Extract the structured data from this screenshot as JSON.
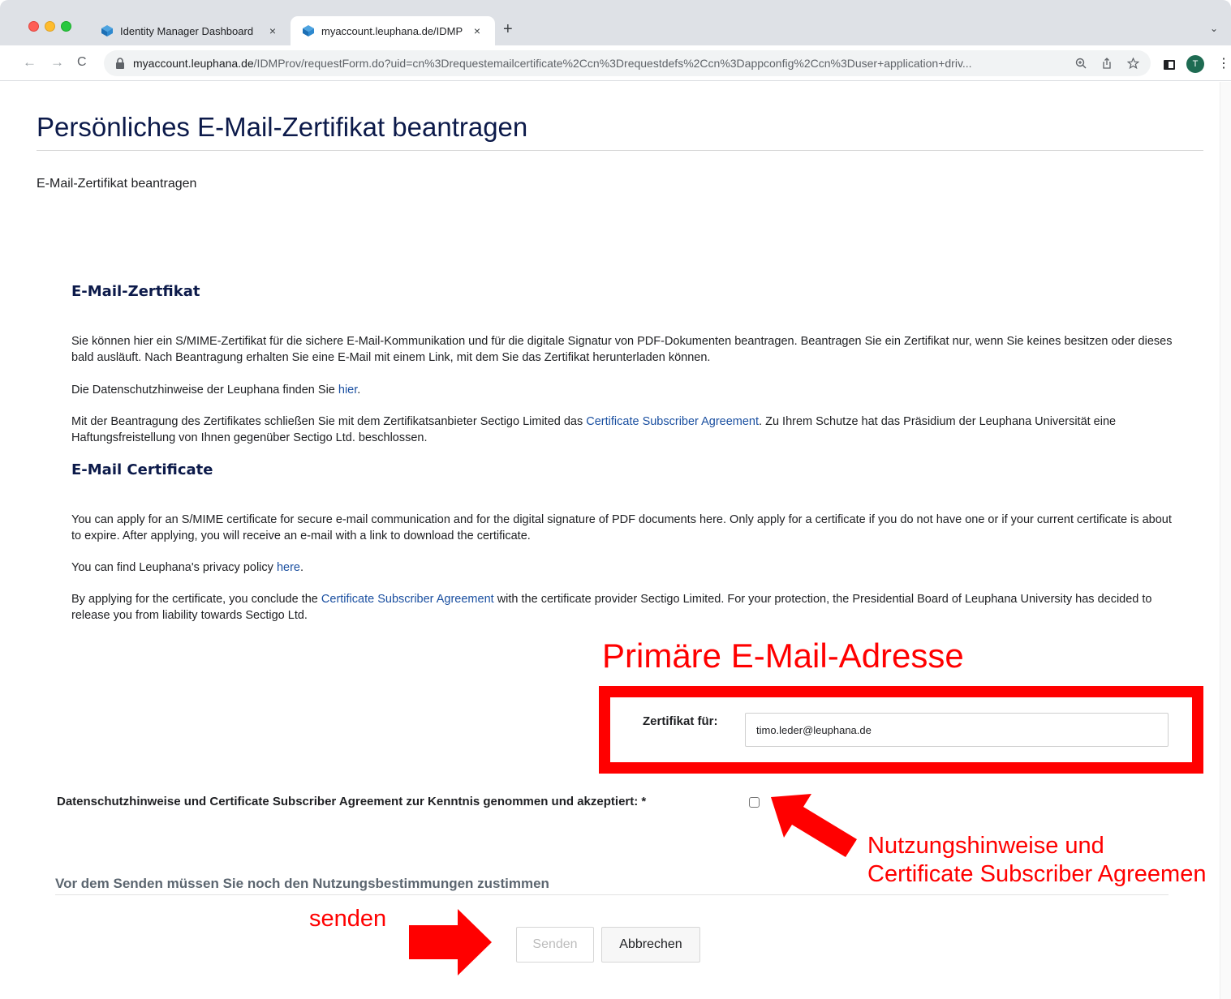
{
  "browser": {
    "tabs": [
      {
        "title": "Identity Manager Dashboard",
        "active": false
      },
      {
        "title": "myaccount.leuphana.de/IDMP",
        "active": true
      }
    ],
    "new_tab": "+",
    "tab_close": "×",
    "url_host": "myaccount.leuphana.de",
    "url_path": "/IDMProv/requestForm.do?uid=cn%3Drequestemailcertificate%2Ccn%3Drequestdefs%2Ccn%3Dappconfig%2Ccn%3Duser+application+driv...",
    "avatar_initial": "T",
    "nav": {
      "back": "←",
      "forward": "→",
      "reload": "C"
    },
    "kebab": "⋮",
    "tab_menu": "⌄"
  },
  "page": {
    "title": "Persönliches E-Mail-Zertifikat beantragen",
    "subtitle": "E-Mail-Zertifikat beantragen",
    "de": {
      "heading": "E-Mail-Zertfikat",
      "p1": "Sie können hier ein S/MIME-Zertifikat für die sichere E-Mail-Kommunikation und für die digitale Signatur von PDF-Dokumenten beantragen. Beantragen Sie ein Zertifikat nur, wenn Sie keines besitzen oder dieses bald ausläuft. Nach Beantragung erhalten Sie eine E-Mail mit einem Link, mit dem Sie das Zertifikat herunterladen können.",
      "p2_before": "Die Datenschutzhinweise der Leuphana finden Sie ",
      "p2_link": "hier",
      "p2_after": ".",
      "p3_before": "Mit der Beantragung des Zertifikates schließen Sie mit dem Zertifikatsanbieter Sectigo Limited das ",
      "p3_link": "Certificate Subscriber Agreement",
      "p3_after": ". Zu Ihrem Schutze hat das Präsidium der Leuphana Universität eine Haftungsfreistellung von Ihnen gegenüber Sectigo Ltd. beschlossen."
    },
    "en": {
      "heading": "E-Mail Certificate",
      "p1": "You can apply for an S/MIME certificate for secure e-mail communication and for the digital signature of PDF documents here. Only apply for a certificate if you do not have one or if your current certificate is about to expire. After applying, you will receive an e-mail with a link to download the certificate.",
      "p2_before": "You can find Leuphana's privacy policy ",
      "p2_link": "here",
      "p2_after": ".",
      "p3_before": "By applying for the certificate, you conclude the ",
      "p3_link": "Certificate Subscriber Agreement",
      "p3_after": " with the certificate provider Sectigo Limited. For your protection, the Presidential Board of Leuphana University has decided to release you from liability towards Sectigo Ltd."
    },
    "form": {
      "cert_label": "Zertifikat für:",
      "cert_value": "timo.leder@leuphana.de",
      "accept_label": "Datenschutzhinweise und Certificate Subscriber Agreement zur Kenntnis genommen und akzeptiert: *",
      "accept_checked": false,
      "notice": "Vor dem Senden müssen Sie noch den Nutzungsbestimmungen zustimmen",
      "send_label": "Senden",
      "cancel_label": "Abbrechen"
    }
  },
  "annotations": {
    "primary_email": "Primäre E-Mail-Adresse",
    "usage_line1": "Nutzungshinweise und",
    "usage_line2": "Certificate Subscriber Agreemen",
    "send": "senden",
    "color": "#ff0000"
  }
}
